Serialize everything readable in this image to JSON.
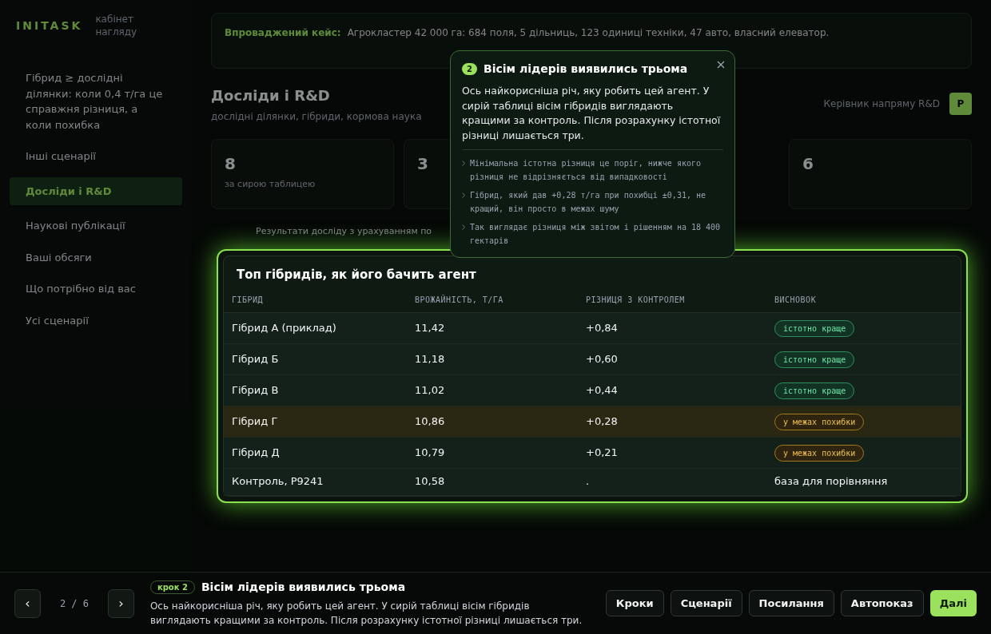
{
  "brand": {
    "logo": "INITASK",
    "subtitle": "кабінет нагляду"
  },
  "sidebar": {
    "items": [
      {
        "label": "Гібрид ≥ дослідні ділянки: коли 0,4 т/га це справжня різниця, а коли похибка",
        "selected": false
      },
      {
        "label": "Інші сценарії",
        "selected": false
      },
      {
        "label": "Досліди і R&D",
        "selected": true
      },
      {
        "label": "Наукові публікації",
        "selected": false
      },
      {
        "label": "Ваші обсяги",
        "selected": false
      },
      {
        "label": "Що потрібно від вас",
        "selected": false
      },
      {
        "label": "Усі сценарії",
        "selected": false
      }
    ]
  },
  "case_banner": {
    "label": "Впроваджений кейс:",
    "text": "Агрокластер 42 000 га: 684 поля, 5 дільниць, 123 одиниці техніки, 47 авто, власний елеватор."
  },
  "page": {
    "title": "Досліди і R&D",
    "subtitle": "дослідні ділянки, гібриди, кормова наука",
    "role": "Керівник напряму R&D",
    "avatar": "Р"
  },
  "stats": [
    {
      "value": "8",
      "note": "за сирою таблицею"
    },
    {
      "value": "3"
    },
    {
      "value": "6"
    }
  ],
  "section": {
    "title": "Результати досліду з урахуванням по"
  },
  "tooltip": {
    "step": "2",
    "title": "Вісім лідерів виявились трьома",
    "body": "Ось найкорисніша річ, яку робить цей агент. У сирій таблиці вісім гібридів виглядають кращими за контроль. Після розрахунку істотної різниці лишається три.",
    "points": [
      "Мінімальна істотна різниця це поріг, нижче якого різниця не відрізняється від випадковості",
      "Гібрид, який дав +0,28 т/га при похибці ±0,31, не кращий, він просто в межах шуму",
      "Так виглядає різниця між звітом і рішенням на 18 400 гектарів"
    ]
  },
  "table": {
    "title": "Топ гібридів, як його бачить агент",
    "columns": [
      "ГІБРИД",
      "ВРОЖАЙНІСТЬ, Т/ГА",
      "РІЗНИЦЯ З КОНТРОЛЕМ",
      "ВИСНОВОК"
    ],
    "rows": [
      {
        "hybrid": "Гібрид А (приклад)",
        "yield": "11,42",
        "diff": "+0,84",
        "verdict": "істотно краще",
        "kind": "significant",
        "highlighted": false
      },
      {
        "hybrid": "Гібрид Б",
        "yield": "11,18",
        "diff": "+0,60",
        "verdict": "істотно краще",
        "kind": "significant",
        "highlighted": false
      },
      {
        "hybrid": "Гібрид В",
        "yield": "11,02",
        "diff": "+0,44",
        "verdict": "істотно краще",
        "kind": "significant",
        "highlighted": false
      },
      {
        "hybrid": "Гібрид Г",
        "yield": "10,86",
        "diff": "+0,28",
        "verdict": "у межах похибки",
        "kind": "noise",
        "highlighted": true
      },
      {
        "hybrid": "Гібрид Д",
        "yield": "10,79",
        "diff": "+0,21",
        "verdict": "у межах похибки",
        "kind": "noise",
        "highlighted": false
      },
      {
        "hybrid": "Контроль, P9241",
        "yield": "10,58",
        "diff": ".",
        "verdict": "база для порівняння",
        "kind": "baseline",
        "highlighted": false
      }
    ]
  },
  "tour": {
    "step_badge": "крок 2",
    "title": "Вісім лідерів виявились трьома",
    "text": "Ось найкорисніша річ, яку робить цей агент. У сирій таблиці вісім гібридів виглядають кращими за контроль. Після розрахунку істотної різниці лишається три.",
    "prev": "‹",
    "next": "›",
    "counter": "2 / 6",
    "buttons": [
      {
        "label": "Кроки",
        "primary": false
      },
      {
        "label": "Сценарії",
        "primary": false
      },
      {
        "label": "Посилання",
        "primary": false
      },
      {
        "label": "Автопоказ",
        "primary": false
      },
      {
        "label": "Далі",
        "primary": true
      }
    ]
  }
}
